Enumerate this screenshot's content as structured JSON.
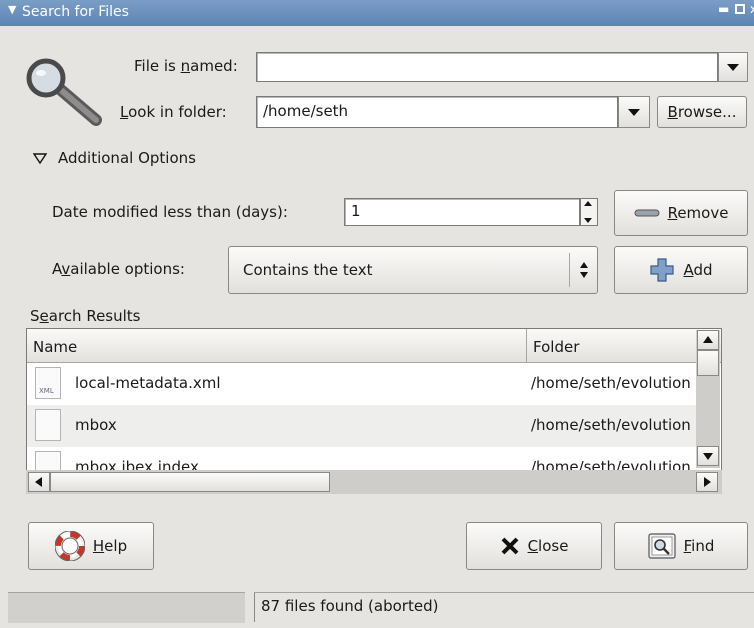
{
  "window": {
    "title": "Search for Files"
  },
  "form": {
    "file_named_label_pre": "File is ",
    "file_named_label_key": "n",
    "file_named_label_post": "amed:",
    "file_named_value": "",
    "look_in_label_key": "L",
    "look_in_label_post": "ook in folder:",
    "look_in_value": "/home/seth",
    "browse_key": "B",
    "browse_post": "rowse..."
  },
  "additional": {
    "expander_label": "Additional Options",
    "date_label": "Date modified less than (days):",
    "date_value": "1",
    "remove_key": "R",
    "remove_post": "emove",
    "available_pre": "A",
    "available_key": "v",
    "available_post": "ailable options:",
    "available_value": "Contains the text",
    "add_key": "A",
    "add_post": "dd"
  },
  "results": {
    "label_pre": "S",
    "label_key": "e",
    "label_post": "arch Results",
    "columns": [
      "Name",
      "Folder"
    ],
    "rows": [
      {
        "name": "local-metadata.xml",
        "folder": "/home/seth/evolution",
        "icon": "xml-file-icon"
      },
      {
        "name": "mbox",
        "folder": "/home/seth/evolution",
        "icon": "file-icon"
      },
      {
        "name": "mbox.ibex.index",
        "folder": "/home/seth/evolution",
        "icon": "file-icon"
      }
    ]
  },
  "buttons": {
    "help_key": "H",
    "help_post": "elp",
    "close_key": "C",
    "close_post": "lose",
    "find_key": "F",
    "find_post": "ind"
  },
  "status": {
    "text": "87 files found (aborted)"
  }
}
